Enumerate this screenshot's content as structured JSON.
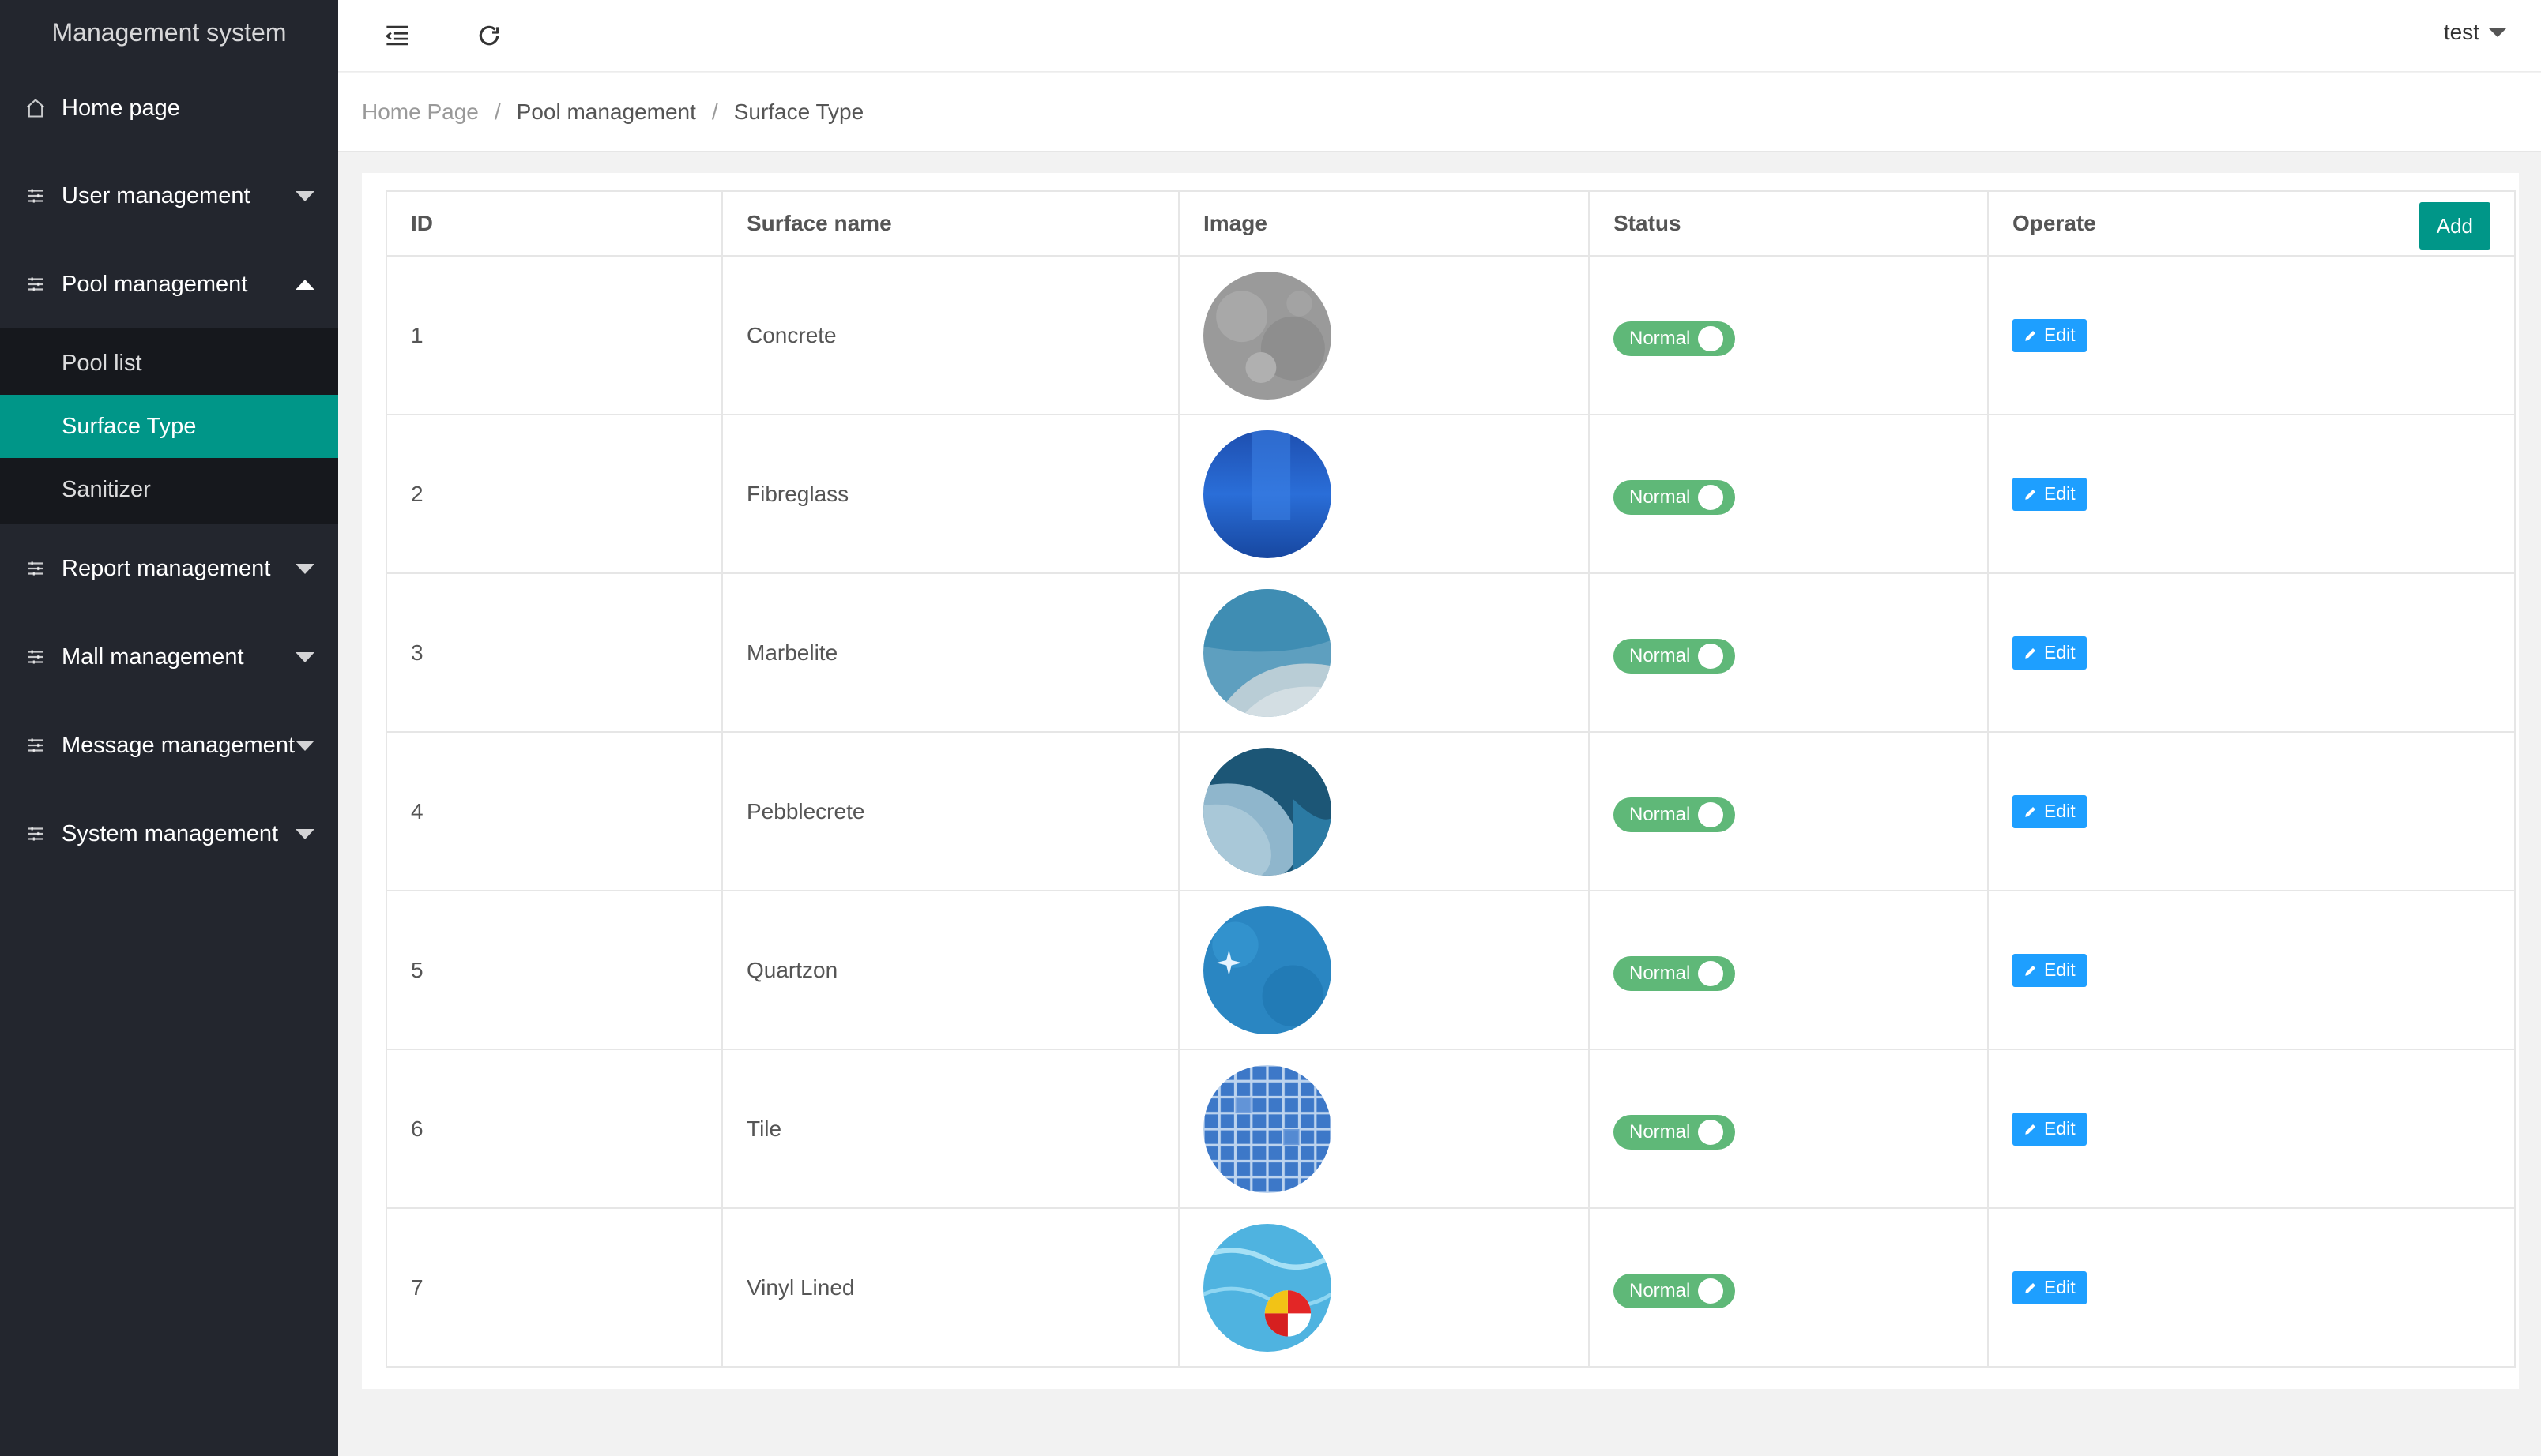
{
  "app": {
    "title": "Management system"
  },
  "sidebar": {
    "home": {
      "label": "Home page",
      "icon": "home-icon"
    },
    "groups_top": [
      {
        "label": "User management",
        "icon": "sliders-icon",
        "expanded": false
      },
      {
        "label": "Pool management",
        "icon": "sliders-icon",
        "expanded": true
      }
    ],
    "pool_submenu": [
      {
        "label": "Pool list",
        "active": false
      },
      {
        "label": "Surface Type",
        "active": true
      },
      {
        "label": "Sanitizer",
        "active": false
      }
    ],
    "groups_bottom": [
      {
        "label": "Report management",
        "icon": "sliders-icon"
      },
      {
        "label": "Mall management",
        "icon": "sliders-icon"
      },
      {
        "label": "Message management",
        "icon": "sliders-icon"
      },
      {
        "label": "System management",
        "icon": "sliders-icon"
      }
    ]
  },
  "header": {
    "menu_toggle_icon": "indent-icon",
    "refresh_icon": "refresh-icon",
    "user": "test"
  },
  "breadcrumb": [
    "Home Page",
    "Pool management",
    "Surface Type"
  ],
  "table": {
    "columns": [
      "ID",
      "Surface name",
      "Image",
      "Status",
      "Operate"
    ],
    "add_label": "Add",
    "edit_label": "Edit",
    "rows": [
      {
        "id": "1",
        "name": "Concrete",
        "status": "Normal",
        "image": "concrete"
      },
      {
        "id": "2",
        "name": "Fibreglass",
        "status": "Normal",
        "image": "fibreglass"
      },
      {
        "id": "3",
        "name": "Marbelite",
        "status": "Normal",
        "image": "marbelite"
      },
      {
        "id": "4",
        "name": "Pebblecrete",
        "status": "Normal",
        "image": "pebblecrete"
      },
      {
        "id": "5",
        "name": "Quartzon",
        "status": "Normal",
        "image": "quartzon"
      },
      {
        "id": "6",
        "name": "Tile",
        "status": "Normal",
        "image": "tile"
      },
      {
        "id": "7",
        "name": "Vinyl Lined",
        "status": "Normal",
        "image": "vinyl"
      }
    ]
  },
  "colors": {
    "sidebar_bg": "#23262e",
    "active_menu": "#009688",
    "switch_on": "#5fb878",
    "edit_button": "#1e9fff",
    "add_button": "#009688"
  }
}
